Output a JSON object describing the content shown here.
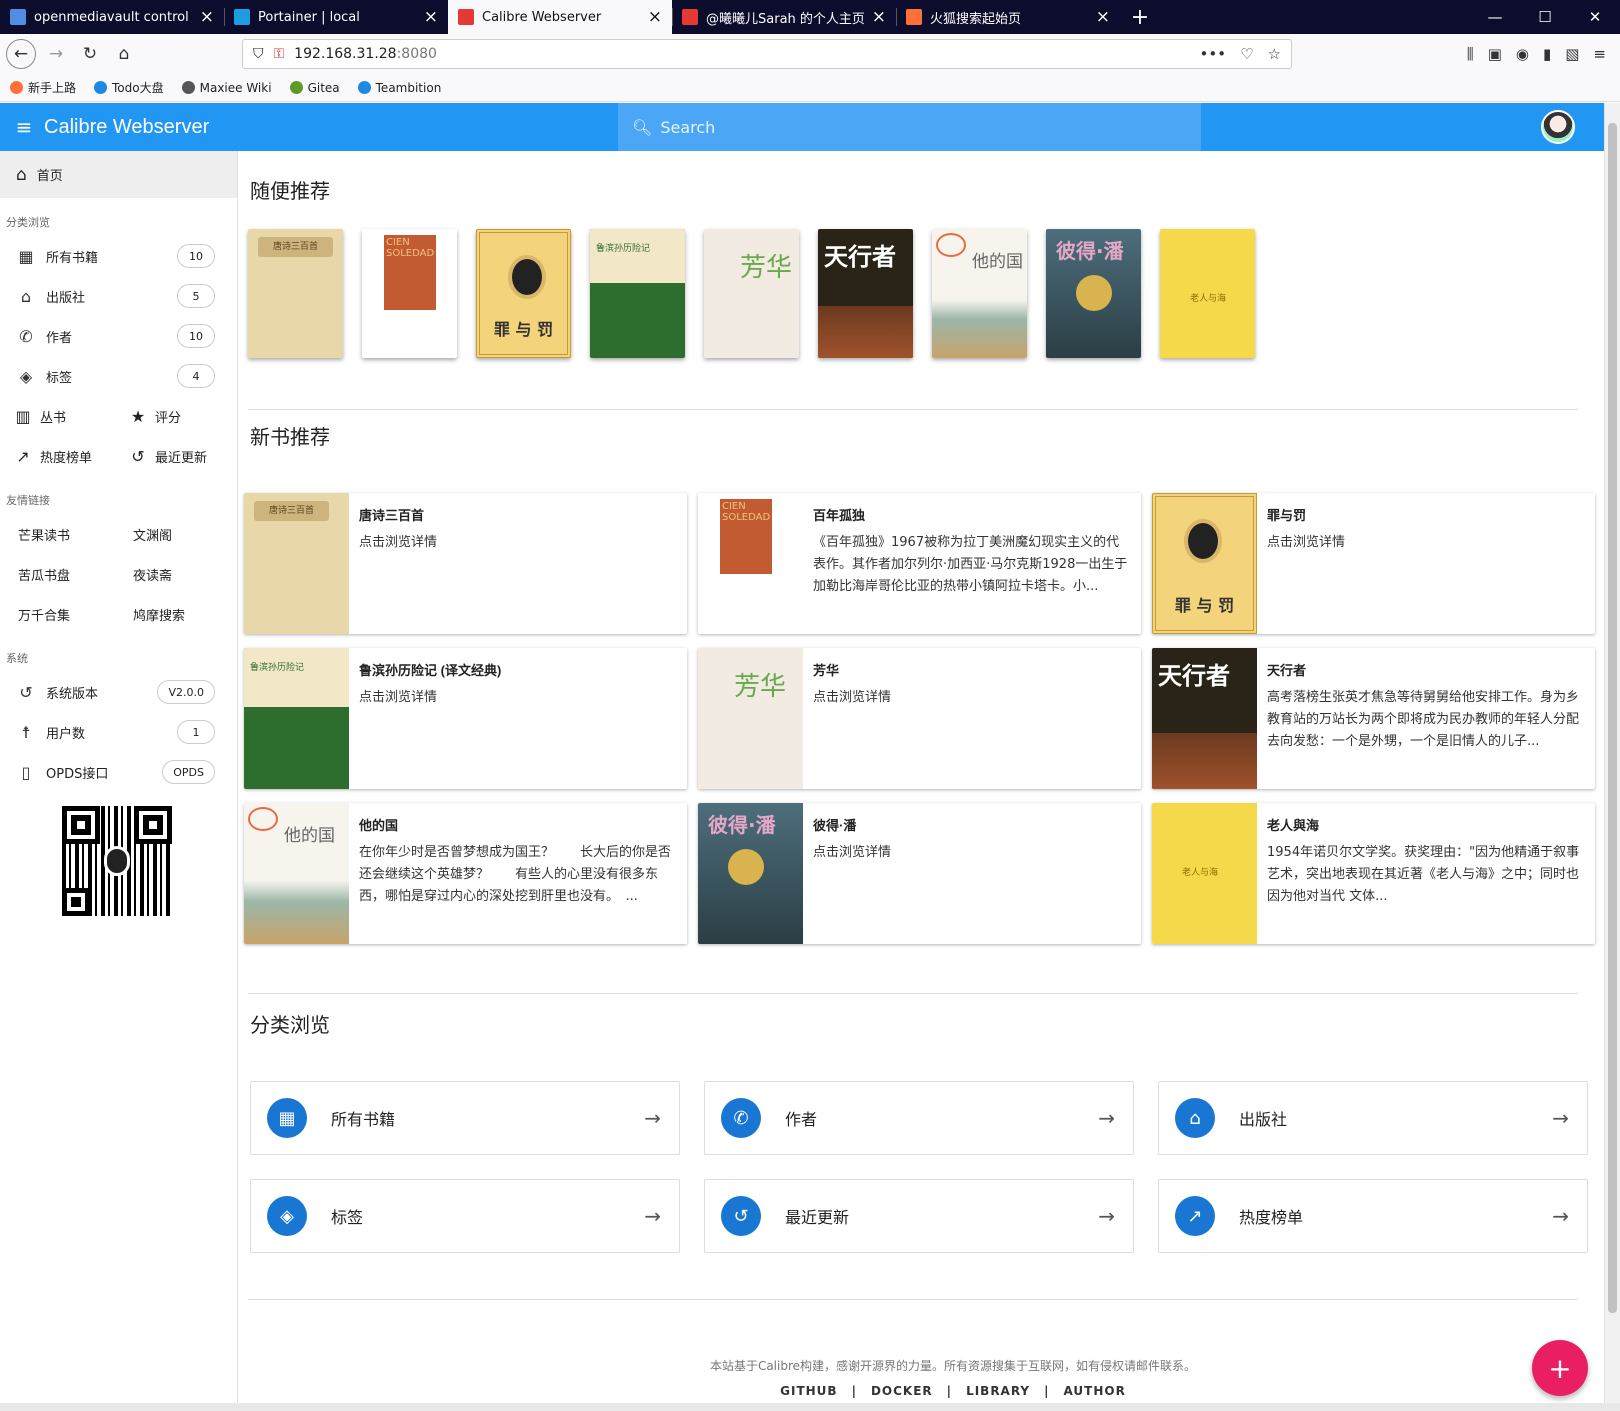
{
  "browser": {
    "tabs": [
      {
        "label": "openmediavault control pan",
        "color": "#4f8ee0"
      },
      {
        "label": "Portainer | local",
        "color": "#1d9de0"
      },
      {
        "label": "Calibre Webserver",
        "color": "#e53935"
      },
      {
        "label": "@曦曦儿Sarah 的个人主页 - 微",
        "color": "#e53935"
      },
      {
        "label": "火狐搜索起始页",
        "color": "#ff7139"
      }
    ],
    "url_host": "192.168.31.28",
    "url_port": ":8080",
    "bookmarks": [
      {
        "label": "新手上路",
        "color": "#ff7139"
      },
      {
        "label": "Todo大盘",
        "color": "#1e88e5"
      },
      {
        "label": "Maxiee Wiki",
        "color": "#555555"
      },
      {
        "label": "Gitea",
        "color": "#609926"
      },
      {
        "label": "Teambition",
        "color": "#1e88e5"
      }
    ]
  },
  "app": {
    "title": "Calibre Webserver",
    "search_placeholder": "Search",
    "accent": "#2196f3"
  },
  "sidebar": {
    "home": "首页",
    "browse_head": "分类浏览",
    "browse": [
      {
        "label": "所有书籍",
        "count": "10",
        "icon": "grid-icon"
      },
      {
        "label": "出版社",
        "count": "5",
        "icon": "publisher-icon"
      },
      {
        "label": "作者",
        "count": "10",
        "icon": "phone-icon"
      },
      {
        "label": "标签",
        "count": "4",
        "icon": "tag-icon"
      }
    ],
    "series": "丛书",
    "rating": "评分",
    "hot": "热度榜单",
    "recent": "最近更新",
    "links_head": "友情链接",
    "links": [
      "芒果读书",
      "文渊阁",
      "苦瓜书盘",
      "夜读斋",
      "万千合集",
      "鸠摩搜索"
    ],
    "system_head": "系统",
    "system": [
      {
        "label": "系统版本",
        "chip": "V2.0.0"
      },
      {
        "label": "用户数",
        "chip": "1"
      },
      {
        "label": "OPDS接口",
        "chip": "OPDS"
      }
    ]
  },
  "random": {
    "title": "随便推荐",
    "covers": [
      {
        "style": "c-tang",
        "text": "唐诗三百首"
      },
      {
        "style": "c-cien",
        "text": "CIEN SOLEDAD"
      },
      {
        "style": "c-zui",
        "text": "罪 与 罚"
      },
      {
        "style": "c-lu",
        "text": "鲁滨孙历险记"
      },
      {
        "style": "c-fang",
        "text": "芳华"
      },
      {
        "style": "c-tian",
        "text": "天行者"
      },
      {
        "style": "c-ta",
        "text": "他的国"
      },
      {
        "style": "c-bi",
        "text": "彼得·潘"
      },
      {
        "style": "c-lao",
        "text": "老人与海"
      }
    ]
  },
  "newbooks": {
    "title": "新书推荐",
    "items": [
      {
        "name": "唐诗三百首",
        "desc": "点击浏览详情",
        "style": "c-tang",
        "cover": "唐诗三百首"
      },
      {
        "name": "百年孤独",
        "desc": "《百年孤独》1967被称为拉丁美洲魔幻现实主义的代表作。其作者加尔列尔·加西亚·马尔克斯1928一出生于加勒比海岸哥伦比亚的热带小镇阿拉卡塔卡。小...",
        "style": "c-cien",
        "cover": "CIEN SOLEDAD"
      },
      {
        "name": "罪与罚",
        "desc": "点击浏览详情",
        "style": "c-zui",
        "cover": "罪 与 罚"
      },
      {
        "name": "鲁滨孙历险记 (译文经典)",
        "desc": "点击浏览详情",
        "style": "c-lu",
        "cover": "鲁滨孙历险记"
      },
      {
        "name": "芳华",
        "desc": "点击浏览详情",
        "style": "c-fang",
        "cover": "芳华"
      },
      {
        "name": "天行者",
        "desc": "高考落榜生张英才焦急等待舅舅给他安排工作。身为乡教育站的万站长为两个即将成为民办教师的年轻人分配去向发愁：一个是外甥，一个是旧情人的儿子...",
        "style": "c-tian",
        "cover": "天行者"
      },
      {
        "name": "他的国",
        "desc": "在你年少时是否曾梦想成为国王？　　长大后的你是否还会继续这个英雄梦？　　有些人的心里没有很多东西，哪怕是穿过内心的深处挖到肝里也没有。　...",
        "style": "c-ta",
        "cover": "他的国"
      },
      {
        "name": "彼得·潘",
        "desc": "点击浏览详情",
        "style": "c-bi",
        "cover": "彼得·潘"
      },
      {
        "name": "老人與海",
        "desc": "1954年诺贝尔文学奖。获奖理由：\"因为他精通于叙事艺术，突出地表现在其近著《老人与海》之中；同时也因为他对当代 文体...",
        "style": "c-lao",
        "cover": "老人与海"
      }
    ]
  },
  "categories": {
    "title": "分类浏览",
    "items": [
      {
        "label": "所有书籍",
        "icon": "grid-icon",
        "glyph": "▦"
      },
      {
        "label": "作者",
        "icon": "phone-icon",
        "glyph": "✆"
      },
      {
        "label": "出版社",
        "icon": "publisher-icon",
        "glyph": "⌂"
      },
      {
        "label": "标签",
        "icon": "tag-icon",
        "glyph": "◈"
      },
      {
        "label": "最近更新",
        "icon": "history-icon",
        "glyph": "↺"
      },
      {
        "label": "热度榜单",
        "icon": "trending-icon",
        "glyph": "↗"
      }
    ]
  },
  "footer": {
    "text": "本站基于Calibre构建，感谢开源界的力量。所有资源搜集于互联网，如有侵权请邮件联系。",
    "links": [
      "GITHUB",
      "DOCKER",
      "LIBRARY",
      "AUTHOR"
    ]
  },
  "fab": "+"
}
